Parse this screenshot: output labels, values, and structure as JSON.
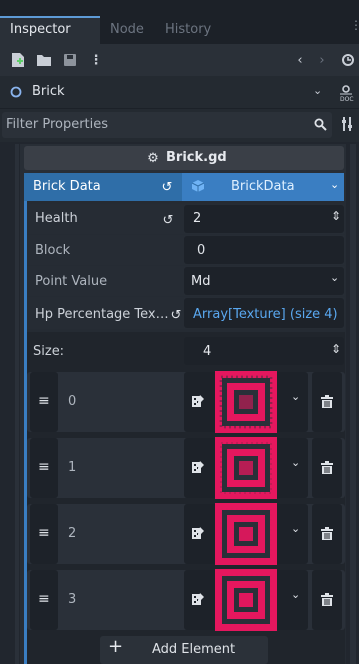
{
  "tabs": [
    "Inspector",
    "Node",
    "History"
  ],
  "object": {
    "name": "Brick"
  },
  "filter": {
    "placeholder": "Filter Properties"
  },
  "script": {
    "name": "Brick.gd"
  },
  "section": {
    "label": "Brick Data",
    "resource": "BrickData"
  },
  "properties": [
    {
      "label": "Health",
      "value": "2"
    },
    {
      "label": "Block",
      "value": "0"
    },
    {
      "label": "Point Value",
      "value": "Md"
    },
    {
      "label": "Hp Percentage Tex…",
      "value": "Array[Texture] (size 4)"
    }
  ],
  "array": {
    "size_label": "Size:",
    "size_value": "4",
    "elements": [
      "0",
      "1",
      "2",
      "3"
    ],
    "add_label": "Add Element"
  },
  "colors": {
    "accent": "#3a7ec2",
    "selected": "#2f6ea8",
    "texture": "#e5175e"
  }
}
